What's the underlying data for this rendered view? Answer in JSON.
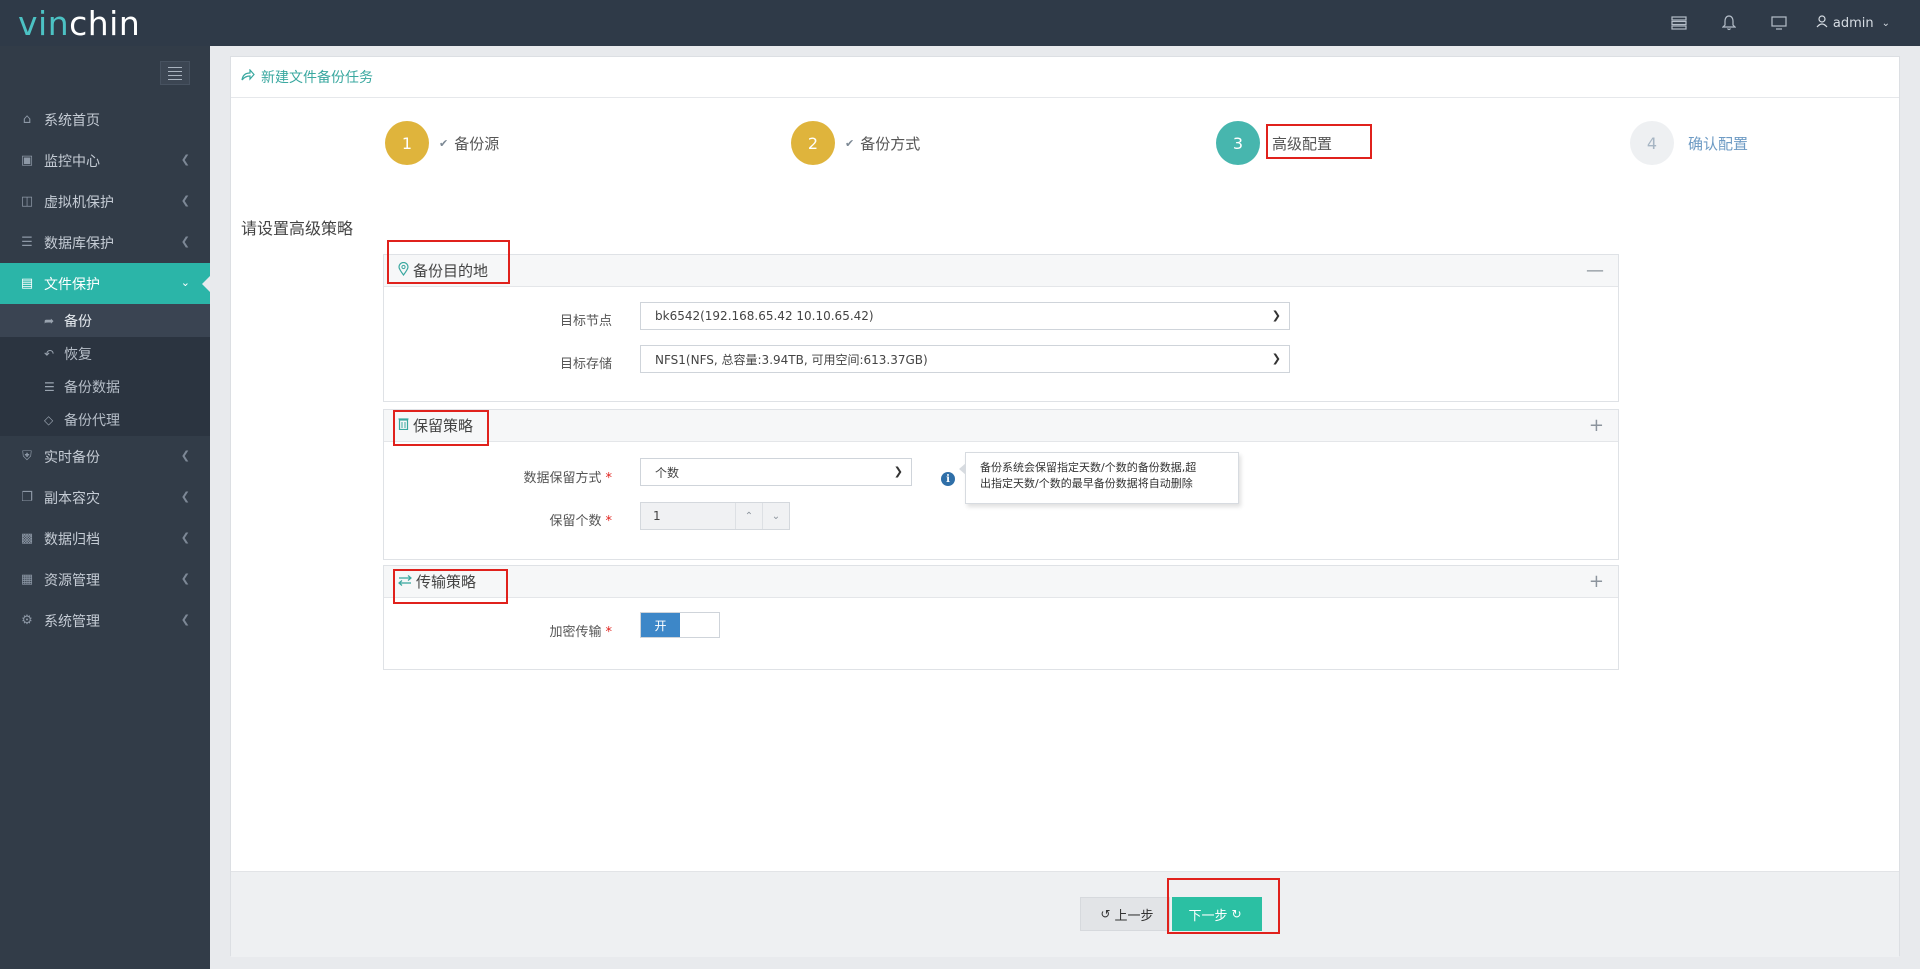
{
  "app": {
    "logo_part1": "vin",
    "logo_part2": "chin"
  },
  "topbar": {
    "icons": [
      "server-icon",
      "bell-icon",
      "monitor-icon"
    ],
    "user": "admin"
  },
  "sidebar": {
    "items": [
      {
        "label": "系统首页",
        "icon": "home-icon",
        "has_arrow": false
      },
      {
        "label": "监控中心",
        "icon": "laptop-icon",
        "has_arrow": true
      },
      {
        "label": "虚拟机保护",
        "icon": "desktop-icon",
        "has_arrow": true
      },
      {
        "label": "数据库保护",
        "icon": "database-icon",
        "has_arrow": true
      },
      {
        "label": "文件保护",
        "icon": "file-icon",
        "has_arrow": true,
        "active": true
      },
      {
        "label": "实时备份",
        "icon": "shield-icon",
        "has_arrow": true
      },
      {
        "label": "副本容灾",
        "icon": "copy-icon",
        "has_arrow": true
      },
      {
        "label": "数据归档",
        "icon": "archive-icon",
        "has_arrow": true
      },
      {
        "label": "资源管理",
        "icon": "grid-icon",
        "has_arrow": true
      },
      {
        "label": "系统管理",
        "icon": "gear-icon",
        "has_arrow": true
      }
    ],
    "sub_items": [
      {
        "label": "备份",
        "icon": "share-icon"
      },
      {
        "label": "恢复",
        "icon": "reply-icon"
      },
      {
        "label": "备份数据",
        "icon": "stack-icon"
      },
      {
        "label": "备份代理",
        "icon": "tag-icon"
      }
    ]
  },
  "page": {
    "title": "新建文件备份任务",
    "subheading": "请设置高级策略",
    "steps": [
      {
        "number": "1",
        "label": "备份源",
        "state": "done"
      },
      {
        "number": "2",
        "label": "备份方式",
        "state": "done"
      },
      {
        "number": "3",
        "label": "高级配置",
        "state": "current"
      },
      {
        "number": "4",
        "label": "确认配置",
        "state": "pending"
      }
    ]
  },
  "sections": {
    "destination": {
      "title": "备份目的地",
      "toggle": "—",
      "node_label": "目标节点",
      "node_value": "bk6542(192.168.65.42 10.10.65.42)",
      "storage_label": "目标存储",
      "storage_value": "NFS1(NFS, 总容量:3.94TB, 可用空间:613.37GB)"
    },
    "retention": {
      "title": "保留策略",
      "toggle": "+",
      "mode_label": "数据保留方式",
      "mode_value": "个数",
      "count_label": "保留个数",
      "count_value": "1",
      "info": "i",
      "tooltip_line1": "备份系统会保留指定天数/个数的备份数据,超",
      "tooltip_line2": "出指定天数/个数的最早备份数据将自动删除"
    },
    "transfer": {
      "title": "传输策略",
      "toggle": "+",
      "encrypt_label": "加密传输",
      "switch_on": "开"
    }
  },
  "footer": {
    "prev_label": "上一步",
    "next_label": "下一步"
  },
  "colors": {
    "accent": "#2bb5a8",
    "step_done": "#dfb43c",
    "step_current": "#47b6ae",
    "highlight_box": "#e0211c",
    "switch_on": "#3d87c8"
  }
}
